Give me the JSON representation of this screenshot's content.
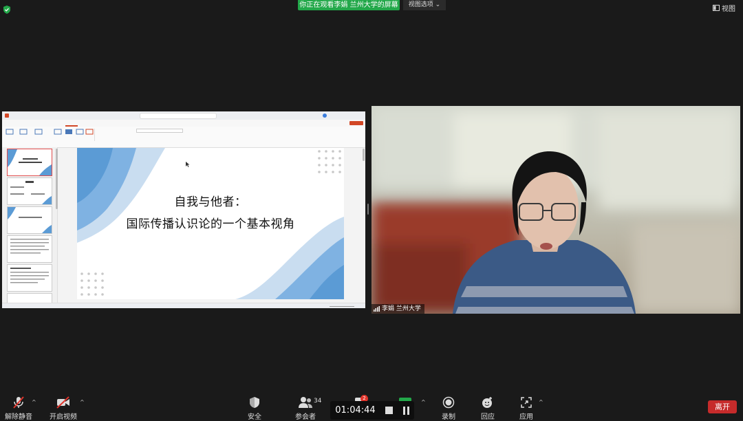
{
  "banner": {
    "text": "你正在观看李娟 兰州大学的屏幕"
  },
  "view_options": {
    "label": "视图选项"
  },
  "view_button": {
    "label": "视图"
  },
  "slide": {
    "title_line1": "自我与他者：",
    "title_line2": "国际传播认识论的一个基本视角"
  },
  "camera": {
    "participant_name": "李娟 兰州大学"
  },
  "toolbar": {
    "unmute_label": "解除静音",
    "start_video_label": "开启视频",
    "security_label": "安全",
    "participants_label": "参会者",
    "participants_count": "34",
    "chat_badge": "2",
    "timer": "01:04:44",
    "record_label": "录制",
    "reactions_label": "回应",
    "apps_label": "应用",
    "leave_label": "离开"
  },
  "colors": {
    "share_green": "#23a84a",
    "leave_red": "#c62b2b",
    "slide_blue": "#5b9bd5"
  }
}
